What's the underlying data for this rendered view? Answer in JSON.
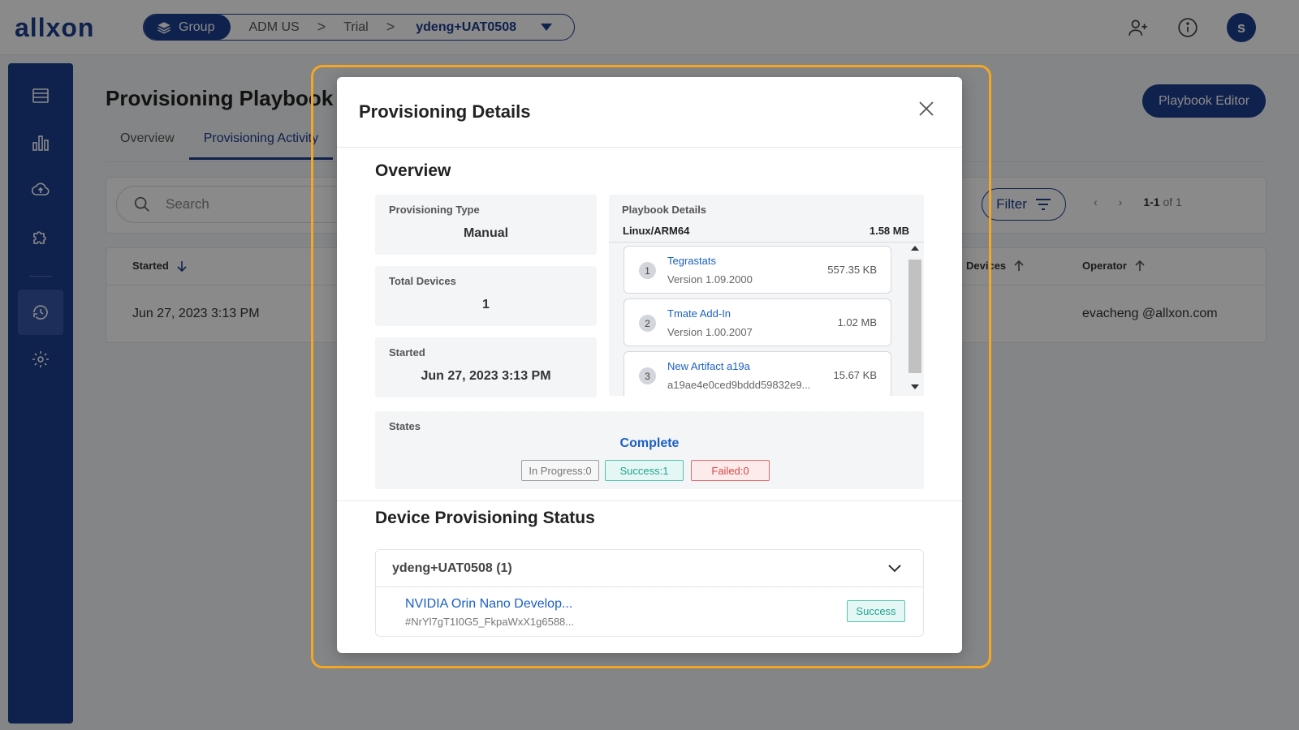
{
  "header": {
    "logo": "allxon",
    "breadcrumb": {
      "group_label": "Group",
      "items": [
        "ADM US",
        "Trial"
      ],
      "current": "ydeng+UAT0508",
      "separator": ">"
    },
    "icons": [
      "add-user-icon",
      "info-icon"
    ],
    "avatar_initial": "s"
  },
  "sidebar": {
    "items": [
      "dashboard-icon",
      "chart-icon",
      "cloud-upload-icon",
      "puzzle-icon",
      "provisioning-icon",
      "settings-icon"
    ],
    "active": "provisioning-icon"
  },
  "page": {
    "title": "Provisioning Playbook",
    "tabs": [
      "Overview",
      "Provisioning Activity"
    ],
    "active_tab": "Provisioning Activity",
    "playbook_editor_label": "Playbook Editor",
    "search_placeholder": "Search",
    "filter_label": "Filter",
    "pager": {
      "range": "1-1",
      "of": "of 1"
    },
    "table": {
      "headers": [
        "Started",
        "Devices",
        "Operator"
      ],
      "rows": [
        {
          "started": "Jun 27, 2023 3:13 PM",
          "operator": "evacheng @allxon.com"
        }
      ]
    }
  },
  "modal": {
    "title": "Provisioning Details",
    "overview_title": "Overview",
    "provisioning_type": {
      "label": "Provisioning Type",
      "value": "Manual"
    },
    "total_devices": {
      "label": "Total Devices",
      "value": "1"
    },
    "started": {
      "label": "Started",
      "value": "Jun 27, 2023 3:13 PM"
    },
    "playbook": {
      "label": "Playbook Details",
      "platform": "Linux/ARM64",
      "total_size": "1.58 MB",
      "artifacts": [
        {
          "num": "1",
          "name": "Tegrastats",
          "detail": "Version 1.09.2000",
          "size": "557.35 KB"
        },
        {
          "num": "2",
          "name": "Tmate Add-In",
          "detail": "Version 1.00.2007",
          "size": "1.02 MB"
        },
        {
          "num": "3",
          "name": "New Artifact a19a",
          "detail": "a19ae4e0ced9bddd59832e9...",
          "size": "15.67 KB"
        }
      ]
    },
    "states": {
      "label": "States",
      "value": "Complete",
      "in_progress": "In Progress:0",
      "success": "Success:1",
      "failed": "Failed:0"
    },
    "device_status": {
      "title": "Device Provisioning Status",
      "group": "ydeng+UAT0508 (1)",
      "device_name": "NVIDIA Orin Nano Develop...",
      "device_id": "#NrYl7gT1I0G5_FkpaWxX1g6588...",
      "status": "Success"
    }
  },
  "colors": {
    "brand": "#1c3d8f",
    "link": "#1c5fc4",
    "success": "#1fa48f",
    "failed": "#d94848",
    "highlight": "#f5a623"
  }
}
